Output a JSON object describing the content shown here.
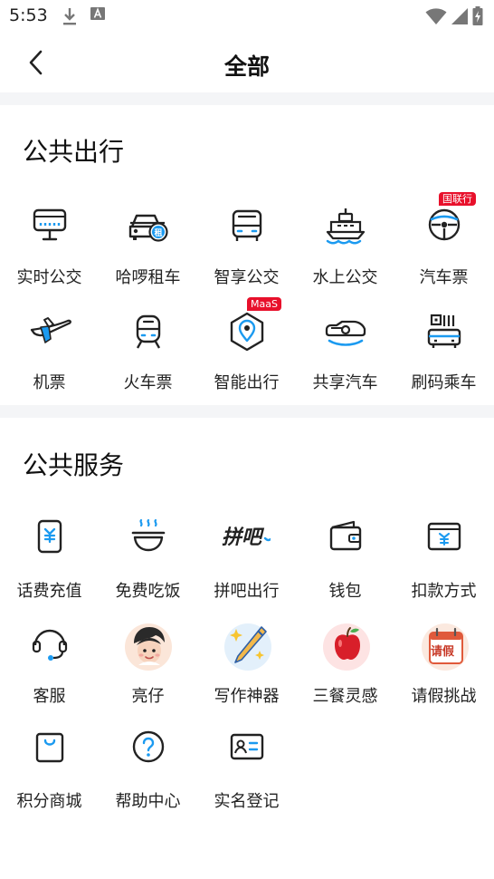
{
  "status_bar": {
    "time": "5:53"
  },
  "header": {
    "title": "全部"
  },
  "sections": [
    {
      "title": "公共出行",
      "items": [
        {
          "label": "实时公交",
          "icon": "bus-stop-icon"
        },
        {
          "label": "哈啰租车",
          "icon": "rent-car-icon"
        },
        {
          "label": "智享公交",
          "icon": "bus-icon"
        },
        {
          "label": "水上公交",
          "icon": "ship-icon"
        },
        {
          "label": "汽车票",
          "icon": "coach-ticket-icon",
          "badge": "国联行"
        },
        {
          "label": "机票",
          "icon": "airplane-icon"
        },
        {
          "label": "火车票",
          "icon": "train-icon"
        },
        {
          "label": "智能出行",
          "icon": "location-hex-icon",
          "badge": "MaaS"
        },
        {
          "label": "共享汽车",
          "icon": "shared-car-icon"
        },
        {
          "label": "刷码乘车",
          "icon": "qr-bus-icon"
        }
      ]
    },
    {
      "title": "公共服务",
      "items": [
        {
          "label": "话费充值",
          "icon": "phone-recharge-icon"
        },
        {
          "label": "免费吃饭",
          "icon": "rice-bowl-icon"
        },
        {
          "label": "拼吧出行",
          "icon": "pinba-logo-icon",
          "logo_text": "拼吧"
        },
        {
          "label": "钱包",
          "icon": "wallet-icon"
        },
        {
          "label": "扣款方式",
          "icon": "payment-card-icon"
        },
        {
          "label": "客服",
          "icon": "headset-icon"
        },
        {
          "label": "亮仔",
          "icon": "avatar-boy-icon"
        },
        {
          "label": "写作神器",
          "icon": "magic-pen-icon"
        },
        {
          "label": "三餐灵感",
          "icon": "apple-icon"
        },
        {
          "label": "请假挑战",
          "icon": "leave-calendar-icon",
          "logo_text": "请假"
        },
        {
          "label": "积分商城",
          "icon": "shopping-bag-icon"
        },
        {
          "label": "帮助中心",
          "icon": "help-circle-icon"
        },
        {
          "label": "实名登记",
          "icon": "id-card-icon"
        }
      ]
    }
  ]
}
